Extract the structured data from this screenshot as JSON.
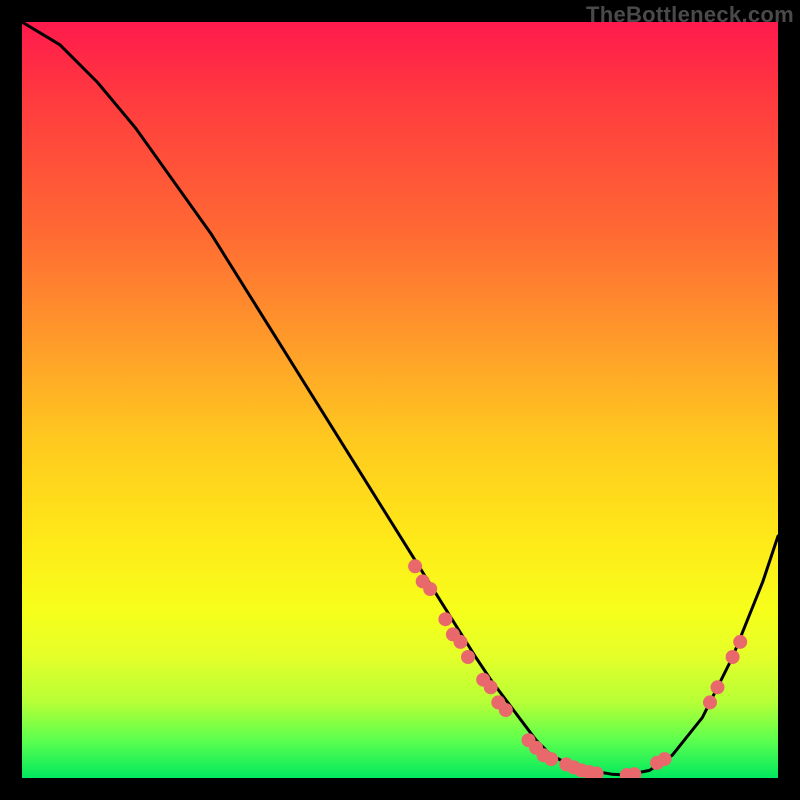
{
  "watermark": "TheBottleneck.com",
  "chart_data": {
    "type": "line",
    "title": "",
    "xlabel": "",
    "ylabel": "",
    "xlim": [
      0,
      100
    ],
    "ylim": [
      0,
      100
    ],
    "series": [
      {
        "name": "curve",
        "x": [
          0,
          5,
          10,
          15,
          20,
          25,
          30,
          35,
          40,
          45,
          50,
          55,
          60,
          62,
          65,
          68,
          70,
          72,
          75,
          78,
          80,
          83,
          86,
          90,
          94,
          98,
          100
        ],
        "y": [
          100,
          97,
          92,
          86,
          79,
          72,
          64,
          56,
          48,
          40,
          32,
          24,
          16,
          13,
          9,
          5,
          3,
          2,
          1,
          0.5,
          0.4,
          1,
          3,
          8,
          16,
          26,
          32
        ]
      }
    ],
    "markers": [
      {
        "x": 52,
        "y": 28
      },
      {
        "x": 53,
        "y": 26
      },
      {
        "x": 54,
        "y": 25
      },
      {
        "x": 56,
        "y": 21
      },
      {
        "x": 57,
        "y": 19
      },
      {
        "x": 58,
        "y": 18
      },
      {
        "x": 59,
        "y": 16
      },
      {
        "x": 61,
        "y": 13
      },
      {
        "x": 62,
        "y": 12
      },
      {
        "x": 63,
        "y": 10
      },
      {
        "x": 64,
        "y": 9
      },
      {
        "x": 67,
        "y": 5
      },
      {
        "x": 68,
        "y": 4
      },
      {
        "x": 69,
        "y": 3
      },
      {
        "x": 70,
        "y": 2.5
      },
      {
        "x": 72,
        "y": 1.8
      },
      {
        "x": 73,
        "y": 1.4
      },
      {
        "x": 74,
        "y": 1.0
      },
      {
        "x": 75,
        "y": 0.8
      },
      {
        "x": 76,
        "y": 0.6
      },
      {
        "x": 80,
        "y": 0.4
      },
      {
        "x": 81,
        "y": 0.5
      },
      {
        "x": 84,
        "y": 2.0
      },
      {
        "x": 85,
        "y": 2.5
      },
      {
        "x": 91,
        "y": 10
      },
      {
        "x": 92,
        "y": 12
      },
      {
        "x": 94,
        "y": 16
      },
      {
        "x": 95,
        "y": 18
      }
    ],
    "colors": {
      "curve_stroke": "#000000",
      "marker_fill": "#e9686b",
      "gradient_top": "#ff1a4d",
      "gradient_mid": "#ffe819",
      "gradient_bottom": "#00e85e"
    }
  }
}
